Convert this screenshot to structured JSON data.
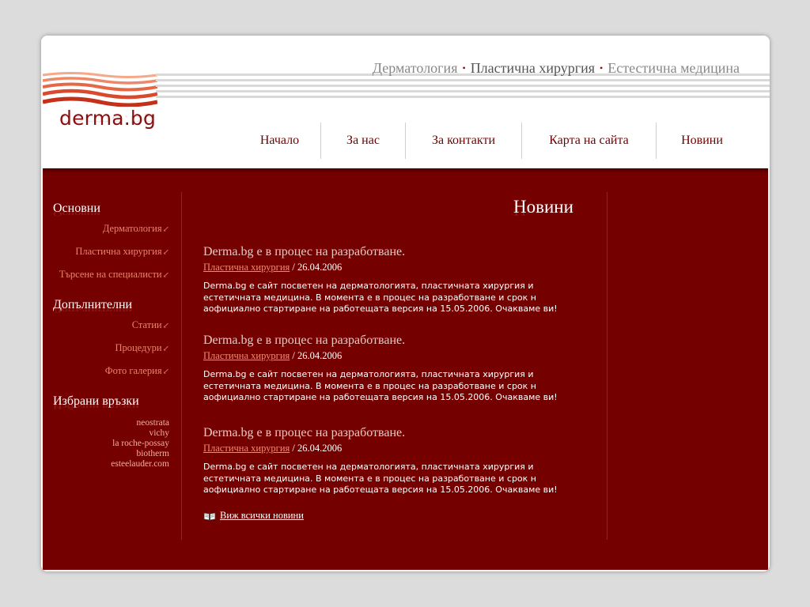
{
  "header": {
    "logo": "derma.bg",
    "tagline": {
      "item1": "Дерматология",
      "item2": "Пластична хирургия",
      "item3": "Естестична медицина",
      "bullet": "•"
    },
    "nav": [
      "Начало",
      "За нас",
      "За контакти",
      "Карта на сайта",
      "Новини"
    ]
  },
  "sidebar": {
    "sections": [
      {
        "title": "Основни",
        "links": [
          "Дерматология",
          "Пластична хирургия",
          "Търсене на специалисти"
        ]
      },
      {
        "title": "Допълнителни",
        "links": [
          "Статии",
          "Процедури",
          "Фото галерия"
        ]
      },
      {
        "title": "Избрани връзки",
        "links": [
          "neostrata",
          "vichy",
          "la roche-possay",
          "biotherm",
          "esteelauder.com"
        ]
      }
    ],
    "arrow": "↙"
  },
  "main": {
    "title": "Новини",
    "articles": [
      {
        "title": "Derma.bg е в процес на разработване.",
        "category": "Пластична хирургия",
        "date": " / 26.04.2006",
        "body": "Derma.bg е сайт посветен на дерматологията, пластичната хирургия и естетичната медицина. В момента е в процес на разработване и срок н аофициално стартиране на работещата версия на 15.05.2006. Очакваме ви!"
      },
      {
        "title": "Derma.bg е в процес на разработване.",
        "category": "Пластична хирургия",
        "date": " / 26.04.2006",
        "body": "Derma.bg е сайт посветен на дерматологията, пластичната хирургия и естетичната медицина. В момента е в процес на разработване и срок н аофициално стартиране на работещата версия на 15.05.2006. Очакваме ви!"
      },
      {
        "title": "Derma.bg е в процес на разработване.",
        "category": "Пластична хирургия",
        "date": " / 26.04.2006",
        "body": "Derma.bg е сайт посветен на дерматологията, пластичната хирургия и естетичната медицина. В момента е в процес на разработване и срок н аофициално стартиране на работещата версия на 15.05.2006. Очакваме ви!"
      }
    ],
    "all_news": "Виж всички новини"
  },
  "colors": {
    "brand": "#740000",
    "nav_text": "#6d0000",
    "link_accent": "#e8846c",
    "page_bg": "#dcdcdc"
  },
  "icons": {
    "book": "book-icon",
    "arrow": "arrow-down-left-icon"
  }
}
